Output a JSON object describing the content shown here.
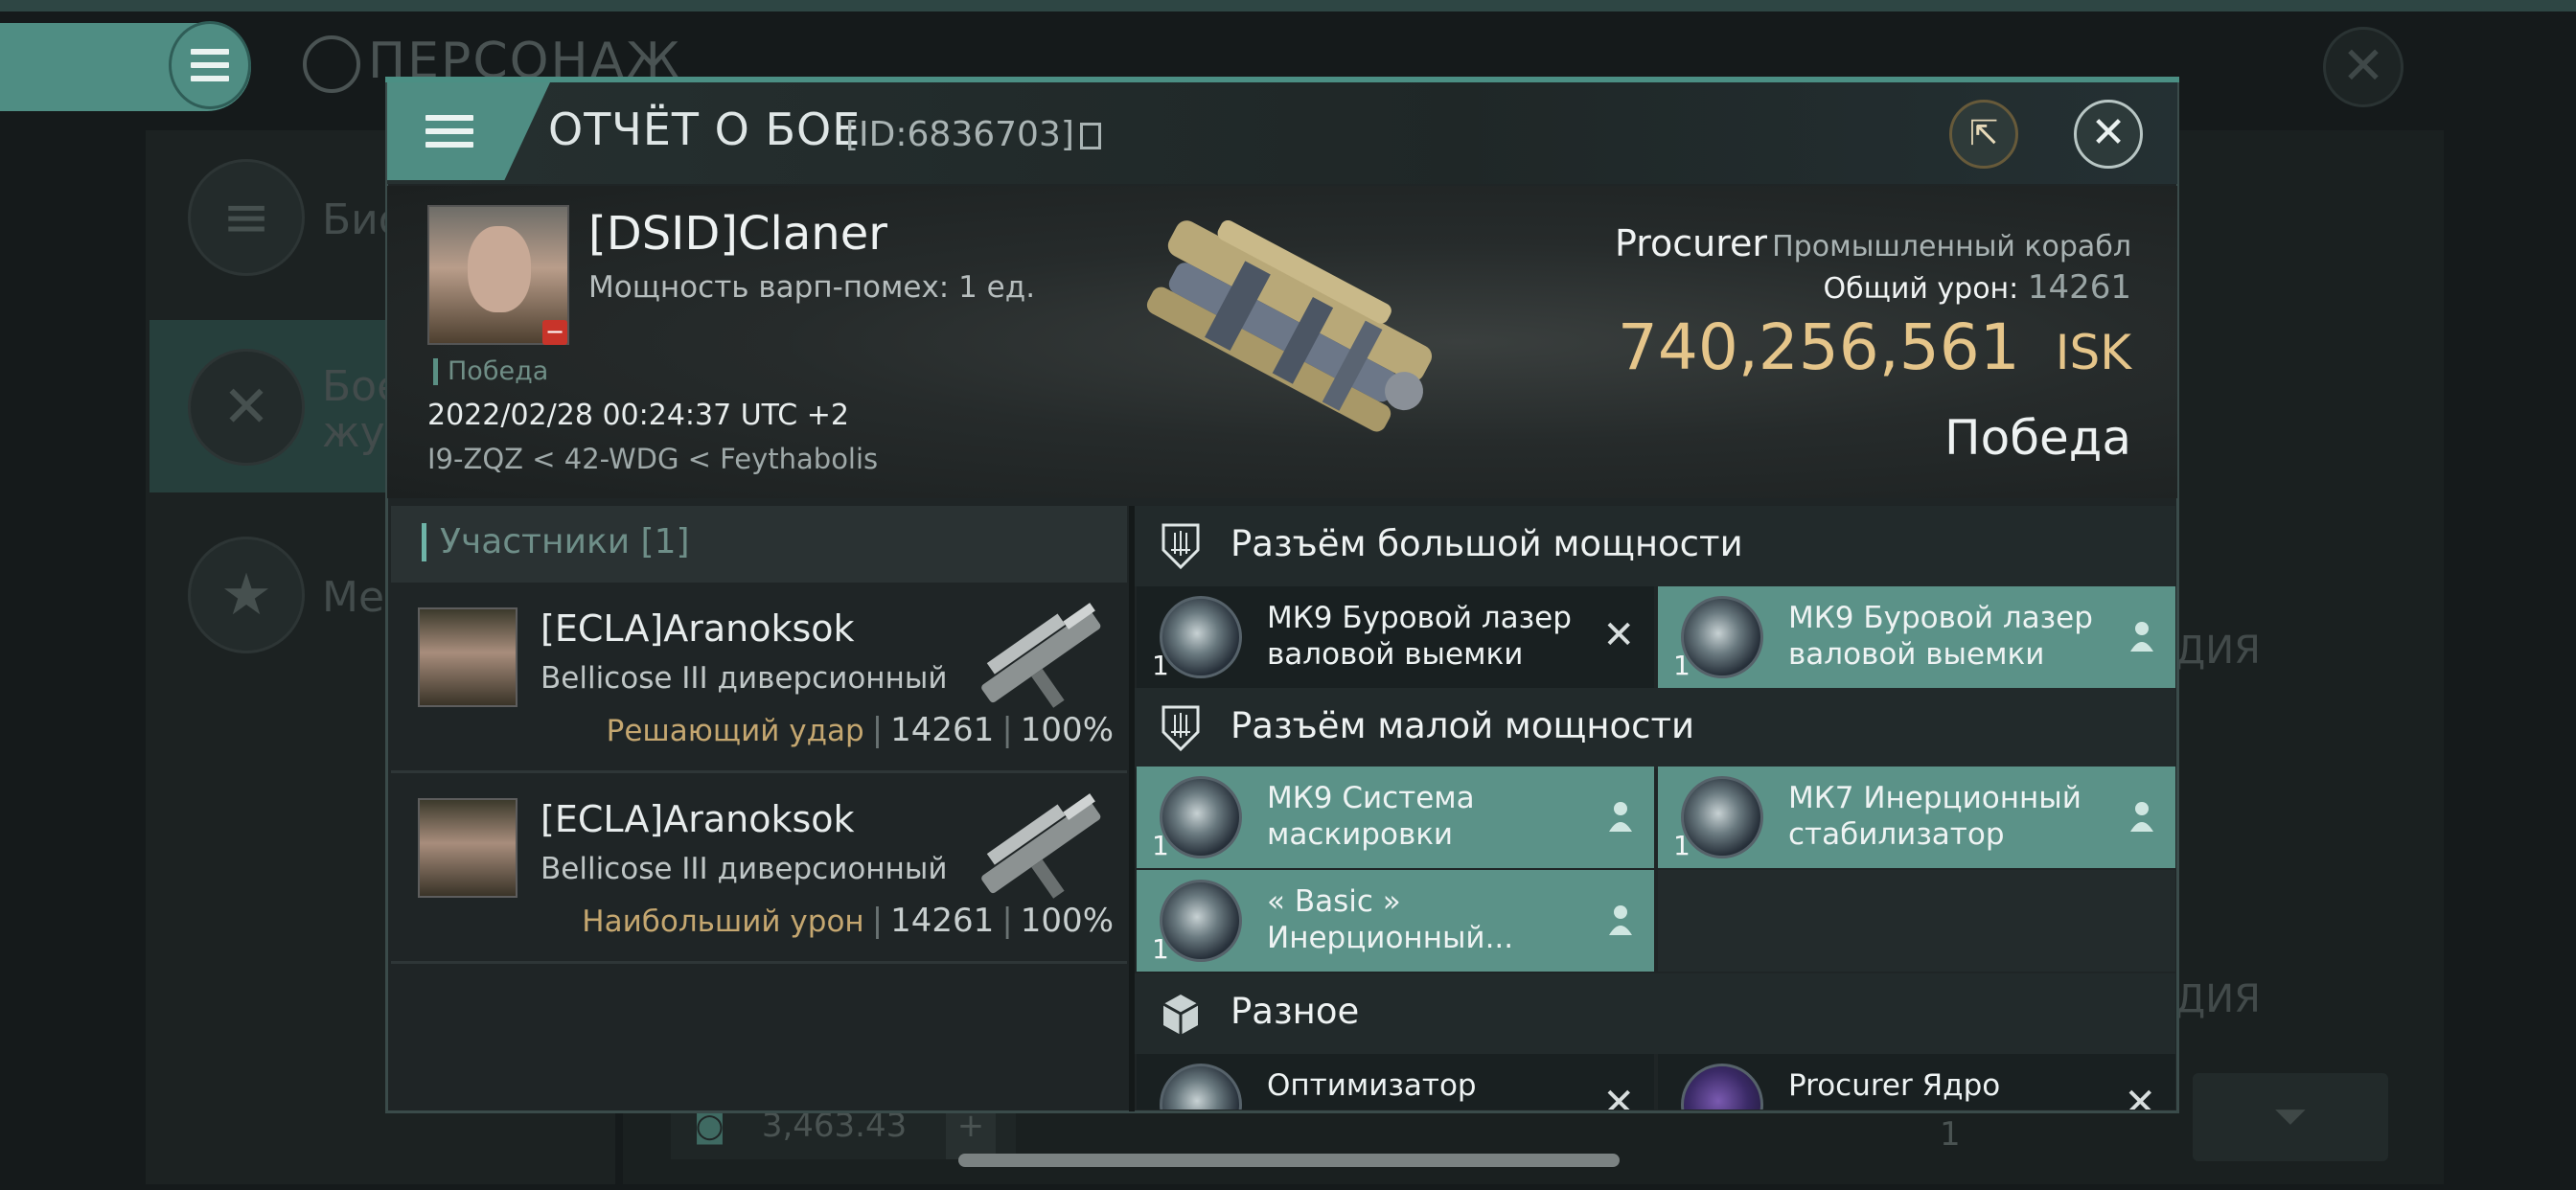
{
  "background": {
    "title": "ПЕРСОНАЖ",
    "left_items": [
      {
        "label": "Био",
        "icon": "list-icon"
      },
      {
        "label": "Боевой журнал",
        "line1": "Бое",
        "line2": "жур",
        "icon": "crossed-swords-icon"
      },
      {
        "label": "Мед",
        "icon": "star-badge-icon"
      }
    ],
    "right_fragments": [
      "ДИЯ",
      "ДИЯ"
    ],
    "bottom_value": "3,463.43",
    "bottom_plus": "+",
    "bottom_qty": "1"
  },
  "report": {
    "title": "ОТЧЁТ О БОЕ",
    "id_label": "[ID:6836703]",
    "victim": {
      "name": "[DSID]Claner",
      "warp_jam": "Мощность варп-помех: 1 ед.",
      "status_small": "Победа",
      "datetime": "2022/02/28 00:24:37 UTC +2",
      "location": "I9-ZQZ < 42-WDG < Feythabolis",
      "ship_name": "Procurer",
      "ship_type": "Промышленный корабл",
      "total_damage_label": "Общий урон:",
      "total_damage": "14261",
      "isk_value": "740,256,561",
      "isk_unit": "ISK",
      "result": "Победа"
    },
    "participants": {
      "header": "Участники [1]",
      "rows": [
        {
          "name": "[ECLA]Aranoksok",
          "ship": "Bellicose III диверсионный",
          "role": "Решающий удар",
          "damage": "14261",
          "percent": "100%"
        },
        {
          "name": "[ECLA]Aranoksok",
          "ship": "Bellicose III диверсионный",
          "role": "Наибольший урон",
          "damage": "14261",
          "percent": "100%"
        }
      ]
    },
    "slots": {
      "high": {
        "title": "Разъём большой мощности",
        "modules": [
          {
            "name": "МК9 Буровой лазер валовой выемки",
            "qty": "1",
            "state": "destroyed"
          },
          {
            "name": "МК9 Буровой лазер валовой выемки",
            "qty": "1",
            "state": "dropped"
          }
        ]
      },
      "low": {
        "title": "Разъём малой мощности",
        "modules": [
          {
            "name": "МК9 Система маскировки",
            "qty": "1",
            "state": "dropped"
          },
          {
            "name": "МК7 Инерционный стабилизатор",
            "qty": "1",
            "state": "dropped"
          },
          {
            "name": "« Basic » Инерционный...",
            "qty": "1",
            "state": "dropped"
          }
        ]
      },
      "misc": {
        "title": "Разное",
        "modules": [
          {
            "name": "Оптимизатор",
            "qty": "",
            "state": "destroyed"
          },
          {
            "name": "Procurer Ядро",
            "qty": "",
            "state": "destroyed"
          }
        ]
      }
    }
  },
  "colors": {
    "accent_teal": "#5b9288",
    "isk_gold": "#e5c58a",
    "role_gold": "#c5a770"
  }
}
